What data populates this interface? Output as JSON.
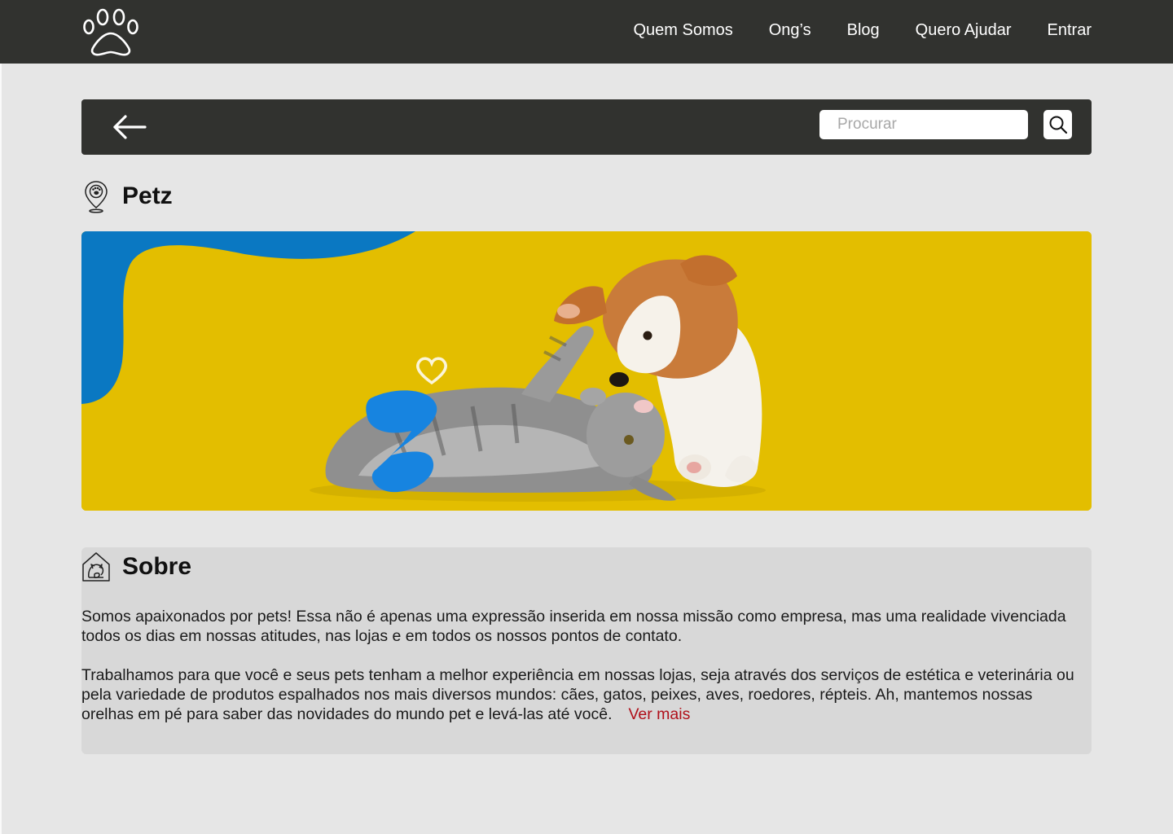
{
  "nav": {
    "links": [
      "Quem Somos",
      "Ong’s",
      "Blog",
      "Quero Ajudar",
      "Entrar"
    ]
  },
  "toolbar": {
    "search_placeholder": "Procurar",
    "back_icon": "arrow-left-icon",
    "search_icon": "search-icon"
  },
  "store": {
    "name": "Petz",
    "icon": "location-pin-paw-icon"
  },
  "banner": {
    "colors": {
      "background": "#e3be00",
      "wave": "#0a78c2"
    }
  },
  "about": {
    "title": "Sobre",
    "icon": "pet-house-icon",
    "paragraph1": "Somos apaixonados por pets! Essa não é apenas uma expressão inserida em nossa missão como empresa, mas uma realidade vivenciada todos os dias em nossas atitudes, nas lojas e em todos os nossos pontos de contato.",
    "paragraph2": "Trabalhamos para que você e seus pets tenham a melhor experiência em nossas lojas, seja através dos serviços de estética e veterinária ou pela variedade de produtos espalhados nos mais diversos mundos: cães, gatos, peixes, aves, roedores, répteis. Ah, mantemos nossas orelhas em pé para saber das novidades do mundo pet e levá-las até você.",
    "more_label": "Ver mais"
  },
  "colors": {
    "nav_background": "#31322f",
    "page_background": "#e6e6e6",
    "card_background": "#d8d8d8",
    "link_accent": "#b0101a"
  }
}
